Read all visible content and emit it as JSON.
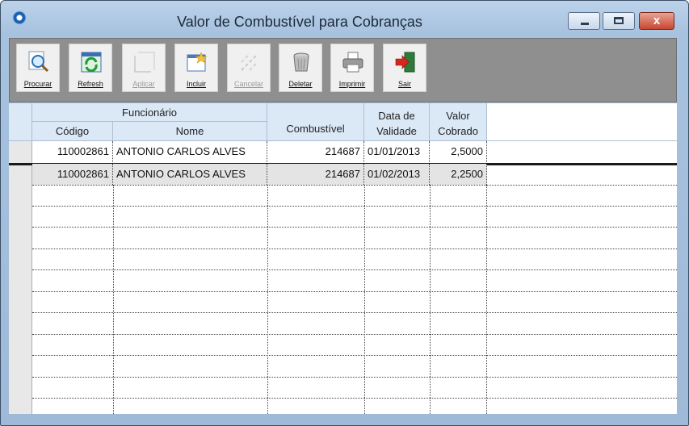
{
  "window": {
    "title": "Valor de Combustível para Cobranças",
    "close_label": "x"
  },
  "toolbar": {
    "buttons": [
      {
        "label": "Procurar",
        "icon": "search-icon",
        "enabled": true
      },
      {
        "label": "Refresh",
        "icon": "refresh-icon",
        "enabled": true
      },
      {
        "label": "Aplicar",
        "icon": "apply-icon",
        "enabled": false
      },
      {
        "label": "Incluir",
        "icon": "add-icon",
        "enabled": true
      },
      {
        "label": "Cancelar",
        "icon": "cancel-icon",
        "enabled": false
      },
      {
        "label": "Deletar",
        "icon": "trash-icon",
        "enabled": true
      },
      {
        "label": "Imprimir",
        "icon": "printer-icon",
        "enabled": true
      },
      {
        "label": "Sair",
        "icon": "exit-icon",
        "enabled": true
      }
    ]
  },
  "grid": {
    "group_header": "Funcionário",
    "columns": {
      "codigo": "Código",
      "nome": "Nome",
      "combustivel": "Combustível",
      "data_validade_l1": "Data de",
      "data_validade_l2": "Validade",
      "valor_l1": "Valor",
      "valor_l2": "Cobrado"
    },
    "rows": [
      {
        "codigo": "110002861",
        "nome": "ANTONIO CARLOS ALVES",
        "combustivel": "214687",
        "data_validade": "01/01/2013",
        "valor": "2,5000"
      },
      {
        "codigo": "110002861",
        "nome": "ANTONIO CARLOS ALVES",
        "combustivel": "214687",
        "data_validade": "01/02/2013",
        "valor": "2,2500"
      }
    ]
  }
}
